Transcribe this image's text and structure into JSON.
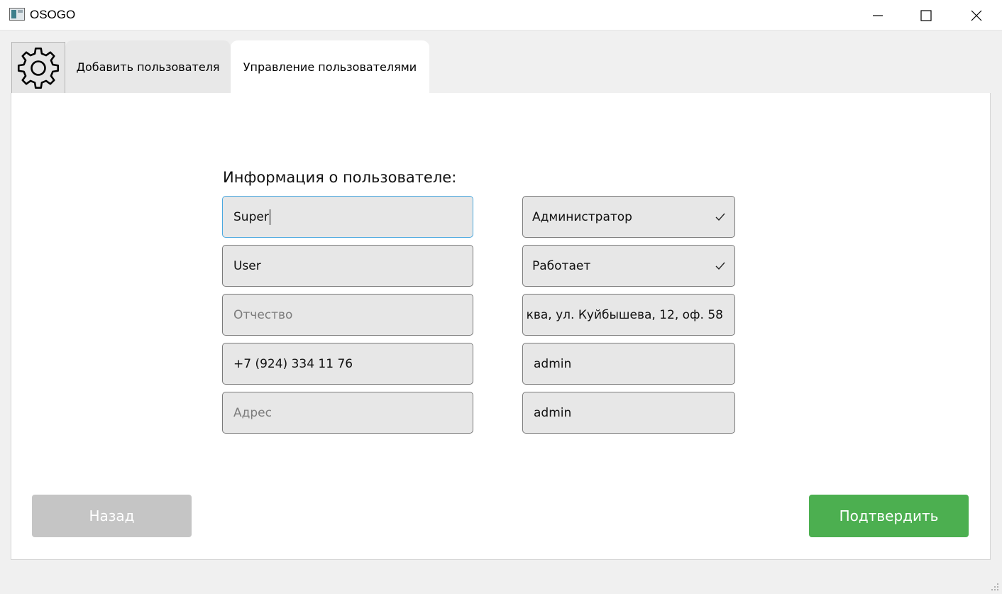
{
  "window": {
    "title": "OSOGO"
  },
  "tabs": [
    {
      "label": "Добавить пользователя",
      "active": false
    },
    {
      "label": "Управление пользователями",
      "active": true
    }
  ],
  "form": {
    "title": "Информация о пользователе:",
    "first_name": {
      "value": "Super"
    },
    "last_name": {
      "value": "User"
    },
    "patronymic": {
      "value": "",
      "placeholder": "Отчество"
    },
    "phone": {
      "value": "+7 (924) 334 11 76"
    },
    "address": {
      "value": "",
      "placeholder": "Адрес"
    },
    "role": {
      "value": "Администратор"
    },
    "status": {
      "value": "Работает"
    },
    "office_address": {
      "value": "ква, ул. Куйбышева, 12, оф. 58"
    },
    "login": {
      "value": "admin"
    },
    "password": {
      "value": "admin"
    }
  },
  "buttons": {
    "back": "Назад",
    "confirm": "Подтвердить"
  },
  "colors": {
    "confirm": "#4caf50",
    "back_disabled": "#c5c5c5",
    "focus_border": "#4aa8df"
  }
}
